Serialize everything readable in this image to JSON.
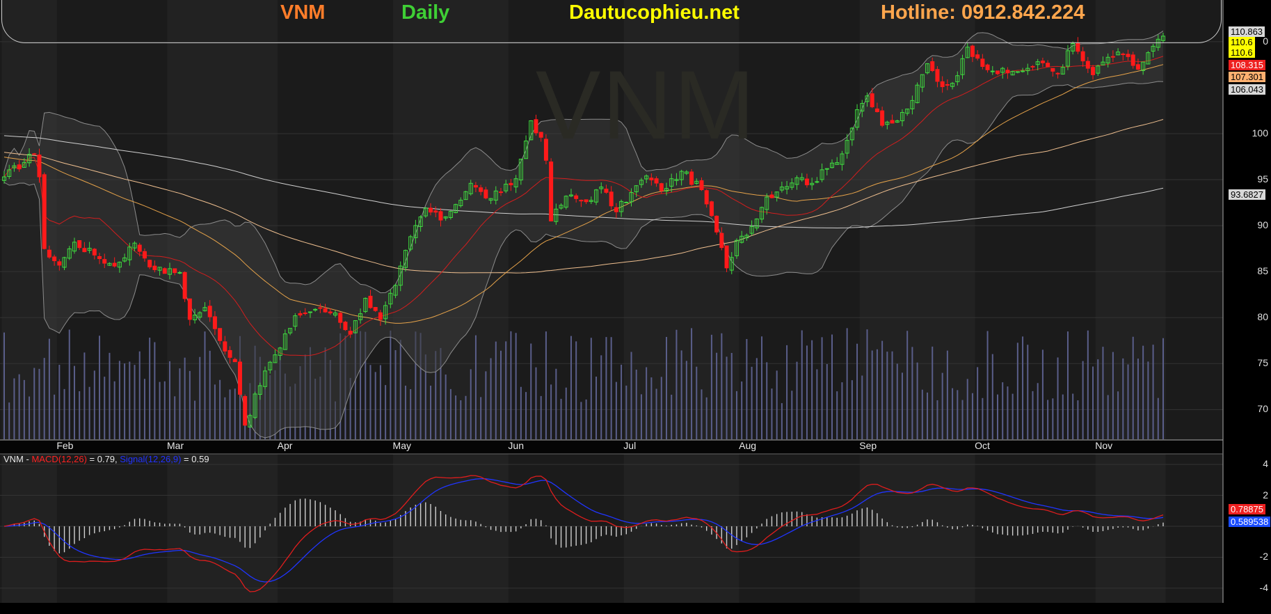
{
  "banner": {
    "ticker": "VNM",
    "period": "Daily",
    "site": "Dautucophieu.net",
    "hotline": "Hotline: 0912.842.224",
    "colors": {
      "ticker": "#ff7d2a",
      "period": "#3fcf35",
      "site": "#ffff00",
      "hotline": "#ffa64d"
    }
  },
  "watermark": "VNM",
  "price_labels": [
    {
      "text": "110.863",
      "bg": "#d8d8d8",
      "fg": "#000000"
    },
    {
      "text": "110.6",
      "bg": "#ffff00",
      "fg": "#000000"
    },
    {
      "text": "110.6",
      "bg": "#ffff00",
      "fg": "#000000"
    },
    {
      "text": "108.315",
      "bg": "#ee2020",
      "fg": "#ffffff"
    },
    {
      "text": "107.301",
      "bg": "#ffb070",
      "fg": "#000000"
    },
    {
      "text": "106.043",
      "bg": "#d8d8d8",
      "fg": "#000000"
    },
    {
      "text": "93.6827",
      "bg": "#d8d8d8",
      "fg": "#000000"
    }
  ],
  "macd_labels": [
    {
      "text": "0.78875",
      "bg": "#ee2020",
      "fg": "#ffffff"
    },
    {
      "text": "0.589538",
      "bg": "#1a4cff",
      "fg": "#ffffff"
    }
  ],
  "macd_legend": {
    "ticker": "VNM",
    "sep": " - ",
    "macd_name": "MACD(12,26)",
    "macd_value": " = 0.79, ",
    "signal_name": "Signal(12,26,9)",
    "signal_value": " = 0.59"
  },
  "chart_data": [
    {
      "type": "candlestick",
      "title": "VNM",
      "ylim": [
        67,
        111.5
      ],
      "yticks": [
        70,
        75,
        80,
        85,
        90,
        95,
        100,
        110
      ],
      "ytick_labels": [
        "70",
        "75",
        "80",
        "85",
        "90",
        "95",
        "100",
        "0"
      ],
      "months": [
        "Feb",
        "Mar",
        "Apr",
        "May",
        "Jun",
        "Jul",
        "Aug",
        "Sep",
        "Oct",
        "Nov"
      ],
      "month_index": [
        11,
        33,
        55,
        78,
        101,
        124,
        147,
        171,
        194,
        218
      ],
      "num_bars": 232,
      "key_points": [
        {
          "i": 0,
          "c": 95.3
        },
        {
          "i": 6,
          "c": 97.8
        },
        {
          "i": 7,
          "c": 95.3
        },
        {
          "i": 8,
          "c": 87.5
        },
        {
          "i": 11,
          "c": 85.7
        },
        {
          "i": 14,
          "c": 88.2
        },
        {
          "i": 18,
          "c": 86.8
        },
        {
          "i": 22,
          "c": 85.6
        },
        {
          "i": 26,
          "c": 88.1
        },
        {
          "i": 30,
          "c": 85.2
        },
        {
          "i": 35,
          "c": 84.9
        },
        {
          "i": 37,
          "c": 79.8
        },
        {
          "i": 40,
          "c": 81.1
        },
        {
          "i": 43,
          "c": 77.5
        },
        {
          "i": 46,
          "c": 75.2
        },
        {
          "i": 48,
          "c": 68.3
        },
        {
          "i": 52,
          "c": 74.2
        },
        {
          "i": 55,
          "c": 76.7
        },
        {
          "i": 58,
          "c": 80.2
        },
        {
          "i": 62,
          "c": 80.9
        },
        {
          "i": 66,
          "c": 80.5
        },
        {
          "i": 69,
          "c": 78.2
        },
        {
          "i": 72,
          "c": 82.1
        },
        {
          "i": 75,
          "c": 79.8
        },
        {
          "i": 78,
          "c": 83.5
        },
        {
          "i": 81,
          "c": 88.8
        },
        {
          "i": 84,
          "c": 91.9
        },
        {
          "i": 87,
          "c": 90.6
        },
        {
          "i": 90,
          "c": 92.3
        },
        {
          "i": 93,
          "c": 94.6
        },
        {
          "i": 96,
          "c": 93.0
        },
        {
          "i": 99,
          "c": 93.6
        },
        {
          "i": 102,
          "c": 95.1
        },
        {
          "i": 105,
          "c": 101.4
        },
        {
          "i": 107,
          "c": 99.6
        },
        {
          "i": 108,
          "c": 97.1
        },
        {
          "i": 109,
          "c": 90.5
        },
        {
          "i": 112,
          "c": 93.2
        },
        {
          "i": 116,
          "c": 92.6
        },
        {
          "i": 119,
          "c": 94.2
        },
        {
          "i": 122,
          "c": 91.5
        },
        {
          "i": 125,
          "c": 93.6
        },
        {
          "i": 128,
          "c": 95.4
        },
        {
          "i": 131,
          "c": 93.8
        },
        {
          "i": 135,
          "c": 95.9
        },
        {
          "i": 139,
          "c": 93.9
        },
        {
          "i": 142,
          "c": 89.3
        },
        {
          "i": 144,
          "c": 85.4
        },
        {
          "i": 146,
          "c": 88.4
        },
        {
          "i": 149,
          "c": 89.9
        },
        {
          "i": 152,
          "c": 93.1
        },
        {
          "i": 155,
          "c": 94.2
        },
        {
          "i": 158,
          "c": 95.2
        },
        {
          "i": 161,
          "c": 94.6
        },
        {
          "i": 164,
          "c": 96.2
        },
        {
          "i": 167,
          "c": 97.8
        },
        {
          "i": 170,
          "c": 102.6
        },
        {
          "i": 172,
          "c": 104.1
        },
        {
          "i": 175,
          "c": 100.9
        },
        {
          "i": 178,
          "c": 101.4
        },
        {
          "i": 181,
          "c": 103.6
        },
        {
          "i": 184,
          "c": 107.6
        },
        {
          "i": 187,
          "c": 105.1
        },
        {
          "i": 190,
          "c": 106.3
        },
        {
          "i": 192,
          "c": 109.4
        },
        {
          "i": 194,
          "c": 108.2
        },
        {
          "i": 197,
          "c": 106.8
        },
        {
          "i": 200,
          "c": 106.6
        },
        {
          "i": 204,
          "c": 107.1
        },
        {
          "i": 207,
          "c": 107.7
        },
        {
          "i": 210,
          "c": 106.5
        },
        {
          "i": 213,
          "c": 109.8
        },
        {
          "i": 215,
          "c": 107.9
        },
        {
          "i": 217,
          "c": 106.4
        },
        {
          "i": 220,
          "c": 108.3
        },
        {
          "i": 223,
          "c": 108.6
        },
        {
          "i": 226,
          "c": 107.0
        },
        {
          "i": 229,
          "c": 109.5
        },
        {
          "i": 231,
          "c": 110.6
        }
      ],
      "up_color": "#3fdc3f",
      "down_color": "#ff1a1a",
      "ma_colors": {
        "bollinger": "#8c8c8c",
        "ma20": "#d31e1e",
        "ma50": "#e6a34a",
        "ma100": "#f0c090",
        "ma200": "#d0d0d0"
      }
    },
    {
      "type": "line",
      "title": "MACD(12,26)",
      "ylim": [
        -4.5,
        4.5
      ],
      "yticks": [
        4,
        2,
        0,
        -2,
        -4
      ],
      "ytick_labels": [
        "4",
        "2",
        "",
        "-2",
        "-4"
      ],
      "series": [
        {
          "name": "MACD(12,26)",
          "color": "#e01d1d",
          "last": 0.79
        },
        {
          "name": "Signal(12,26,9)",
          "color": "#2035ff",
          "last": 0.59
        }
      ]
    }
  ]
}
